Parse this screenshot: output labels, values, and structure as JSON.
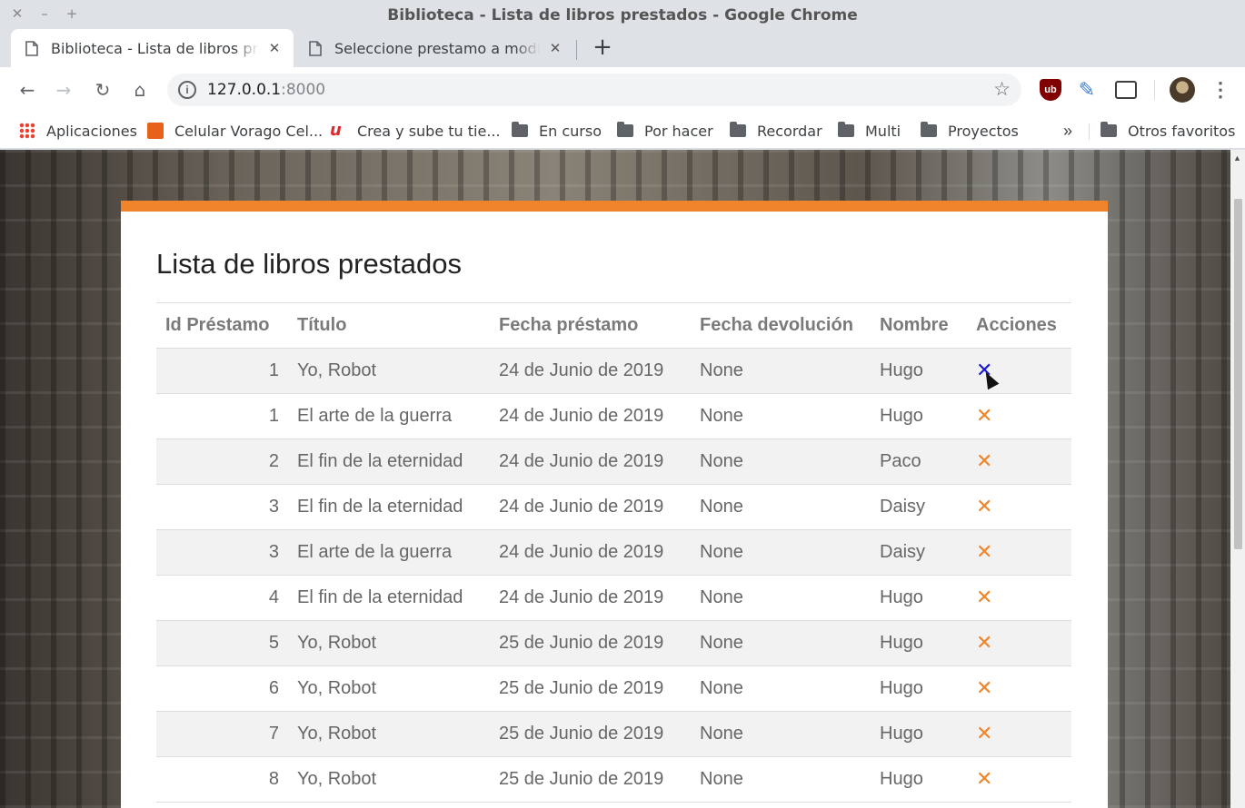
{
  "window": {
    "title": "Biblioteca - Lista de libros prestados - Google Chrome",
    "controls": [
      "✕",
      "–",
      "+"
    ]
  },
  "tabs": [
    {
      "title": "Biblioteca - Lista de libros prestados",
      "active": true
    },
    {
      "title": "Seleccione prestamo a modificar",
      "active": false
    }
  ],
  "toolbar": {
    "url_host": "127.0.0.1",
    "url_port": ":8000"
  },
  "bookmarks": {
    "items": [
      {
        "label": "Aplicaciones",
        "icon": "apps-grid-icon"
      },
      {
        "label": "Celular Vorago Cel...",
        "icon": "vorago-icon"
      },
      {
        "label": "Crea y sube tu tie...",
        "icon": "udemy-icon"
      },
      {
        "label": "En curso",
        "icon": "folder-icon"
      },
      {
        "label": "Por hacer",
        "icon": "folder-icon"
      },
      {
        "label": "Recordar",
        "icon": "folder-icon"
      },
      {
        "label": "Multi",
        "icon": "folder-icon"
      },
      {
        "label": "Proyectos",
        "icon": "folder-icon"
      }
    ],
    "more": "»",
    "other": "Otros favoritos"
  },
  "page": {
    "heading": "Lista de libros prestados",
    "accent_color": "#f0842b",
    "table": {
      "columns": [
        "Id Préstamo",
        "Título",
        "Fecha préstamo",
        "Fecha devolución",
        "Nombre",
        "Acciones"
      ],
      "rows": [
        {
          "id": "1",
          "titulo": "Yo, Robot",
          "fecha_prestamo": "24 de Junio de 2019",
          "fecha_devolucion": "None",
          "nombre": "Hugo"
        },
        {
          "id": "1",
          "titulo": "El arte de la guerra",
          "fecha_prestamo": "24 de Junio de 2019",
          "fecha_devolucion": "None",
          "nombre": "Hugo"
        },
        {
          "id": "2",
          "titulo": "El fin de la eternidad",
          "fecha_prestamo": "24 de Junio de 2019",
          "fecha_devolucion": "None",
          "nombre": "Paco"
        },
        {
          "id": "3",
          "titulo": "El fin de la eternidad",
          "fecha_prestamo": "24 de Junio de 2019",
          "fecha_devolucion": "None",
          "nombre": "Daisy"
        },
        {
          "id": "3",
          "titulo": "El arte de la guerra",
          "fecha_prestamo": "24 de Junio de 2019",
          "fecha_devolucion": "None",
          "nombre": "Daisy"
        },
        {
          "id": "4",
          "titulo": "El fin de la eternidad",
          "fecha_prestamo": "24 de Junio de 2019",
          "fecha_devolucion": "None",
          "nombre": "Hugo"
        },
        {
          "id": "5",
          "titulo": "Yo, Robot",
          "fecha_prestamo": "25 de Junio de 2019",
          "fecha_devolucion": "None",
          "nombre": "Hugo"
        },
        {
          "id": "6",
          "titulo": "Yo, Robot",
          "fecha_prestamo": "25 de Junio de 2019",
          "fecha_devolucion": "None",
          "nombre": "Hugo"
        },
        {
          "id": "7",
          "titulo": "Yo, Robot",
          "fecha_prestamo": "25 de Junio de 2019",
          "fecha_devolucion": "None",
          "nombre": "Hugo"
        },
        {
          "id": "8",
          "titulo": "Yo, Robot",
          "fecha_prestamo": "25 de Junio de 2019",
          "fecha_devolucion": "None",
          "nombre": "Hugo"
        }
      ],
      "delete_glyph": "✕",
      "delete_color": "#f0842b",
      "hover_color": "#1a1acc"
    }
  }
}
